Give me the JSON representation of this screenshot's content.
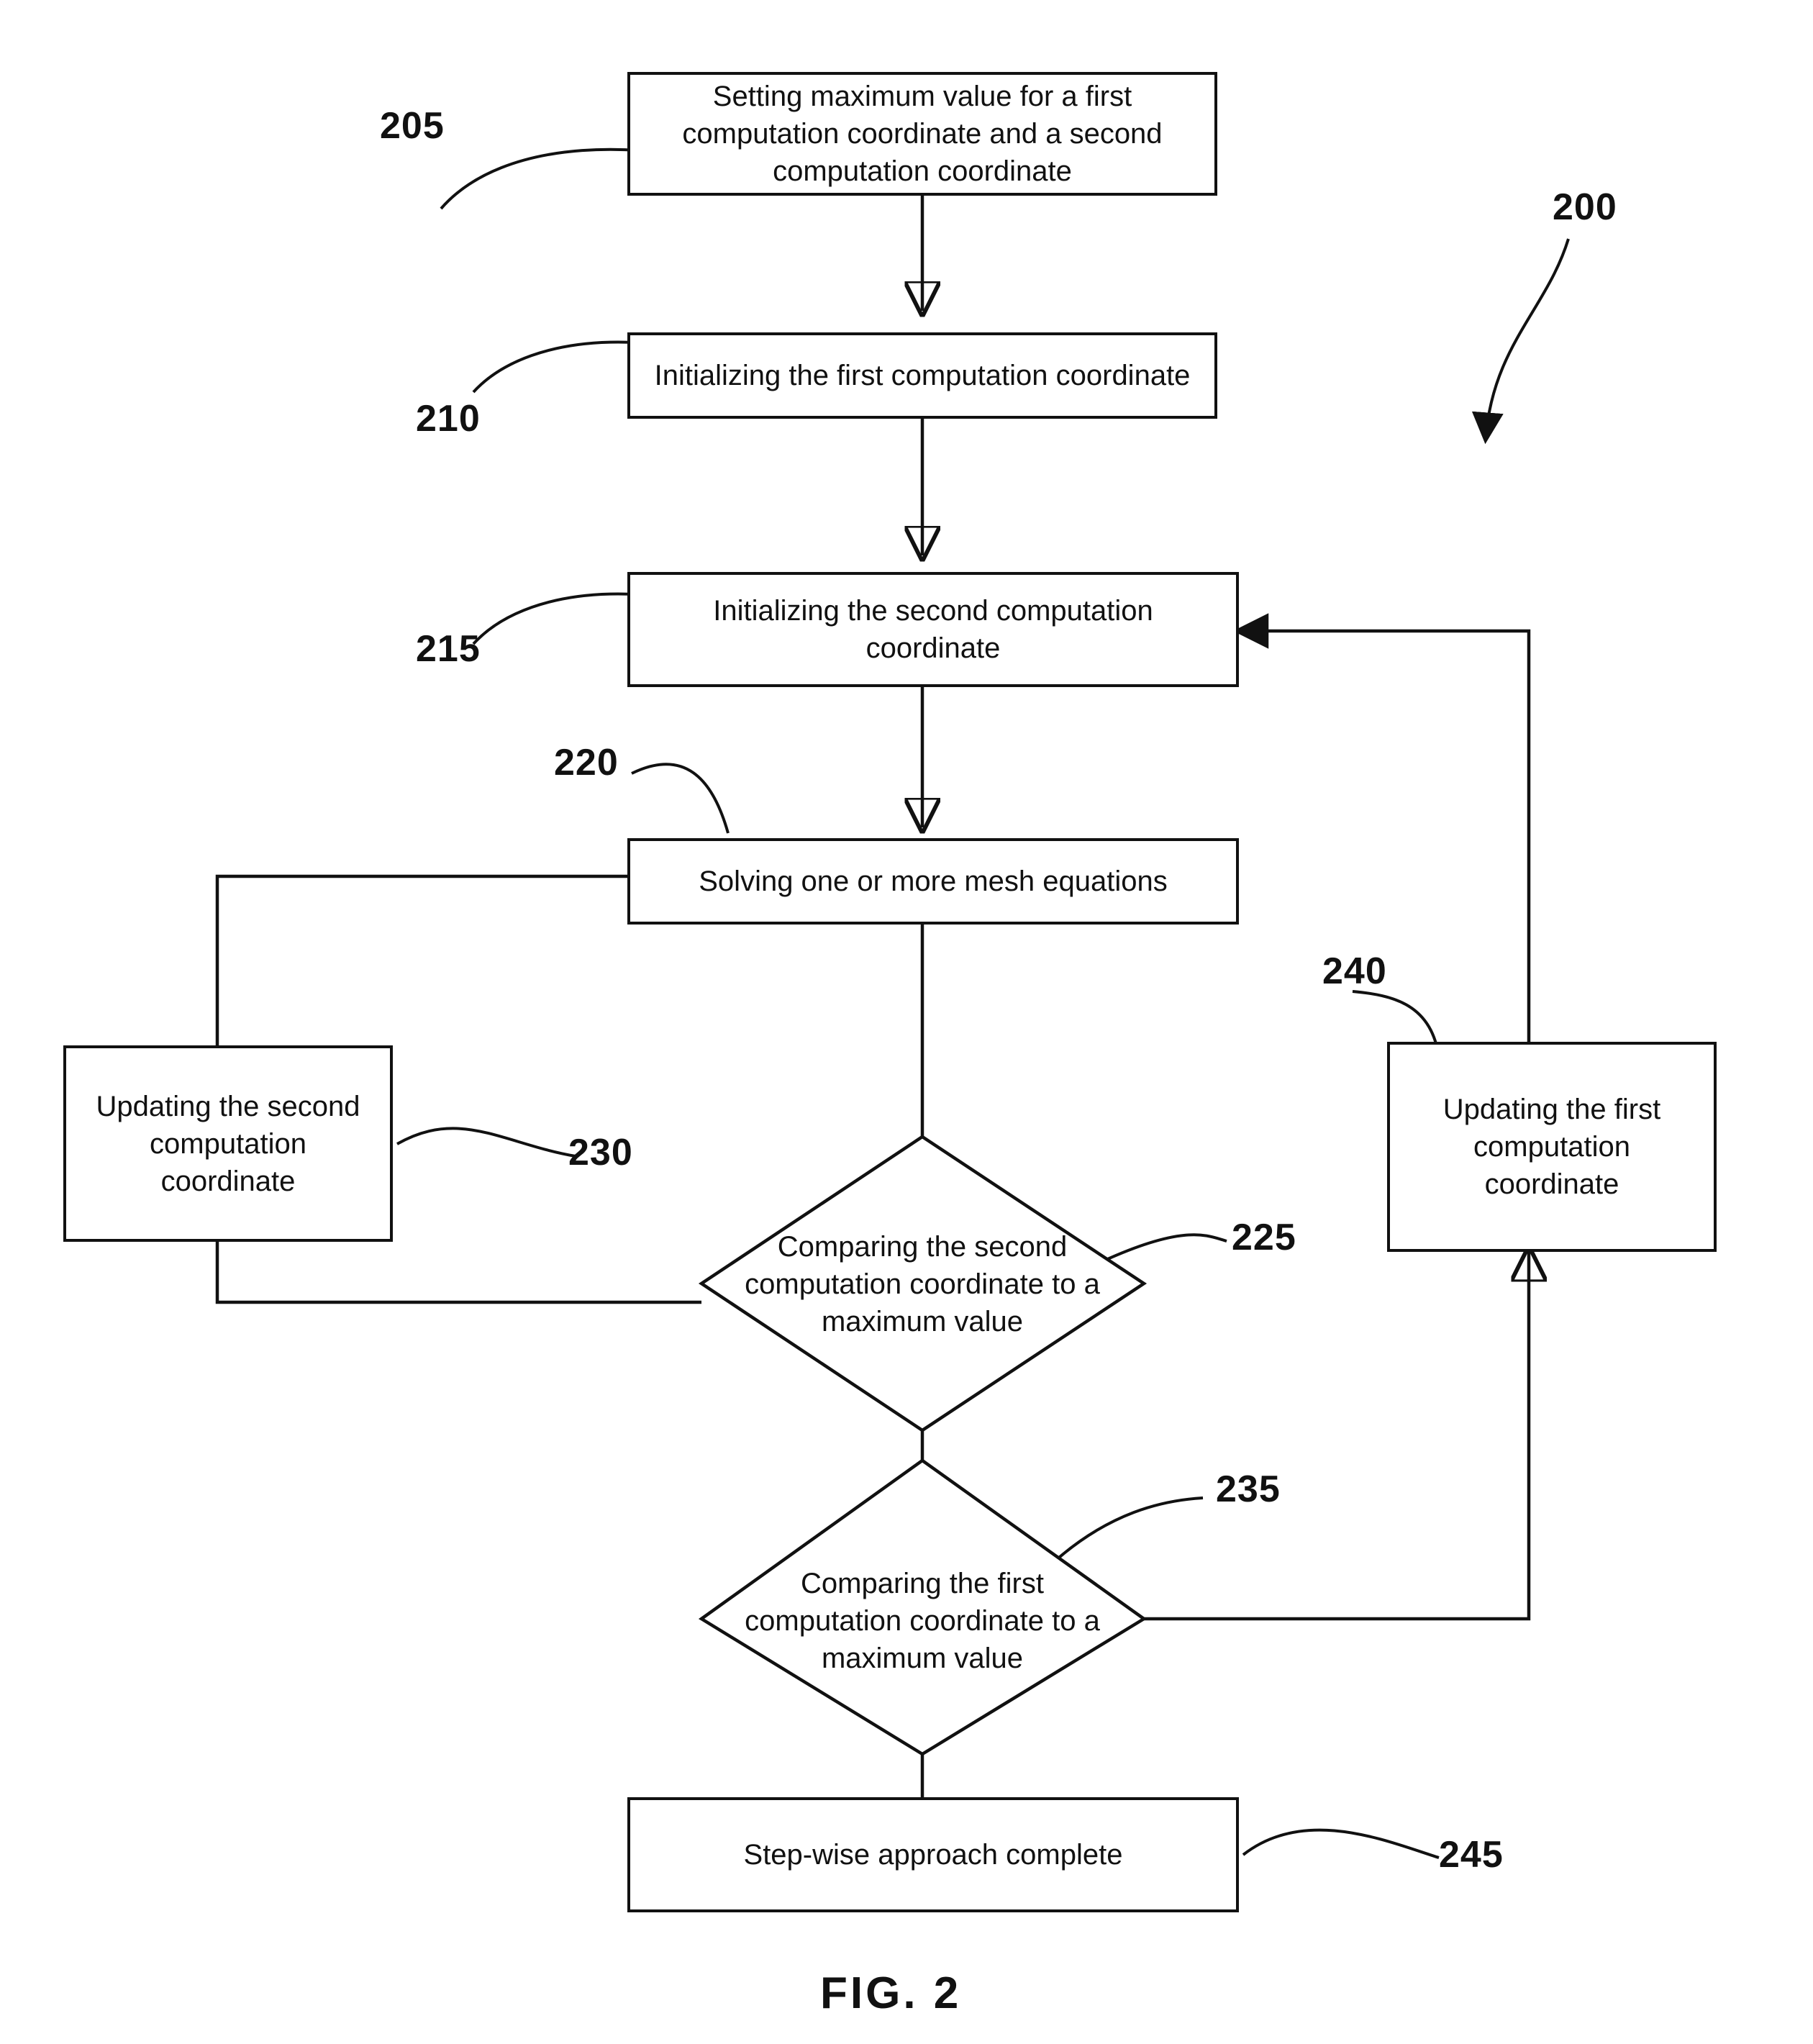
{
  "figure": {
    "caption": "FIG. 2",
    "diagram_ref": "200"
  },
  "nodes": [
    {
      "ref": "205",
      "shape": "process",
      "label": "Setting maximum value for a first computation coordinate and a second computation coordinate"
    },
    {
      "ref": "210",
      "shape": "process",
      "label": "Initializing the first computation coordinate"
    },
    {
      "ref": "215",
      "shape": "process",
      "label": "Initializing the second computation coordinate"
    },
    {
      "ref": "220",
      "shape": "process",
      "label": "Solving one or more mesh equations"
    },
    {
      "ref": "225",
      "shape": "decision",
      "label": "Comparing the second computation coordinate to a maximum value"
    },
    {
      "ref": "230",
      "shape": "process",
      "label": "Updating the second computation coordinate"
    },
    {
      "ref": "235",
      "shape": "decision",
      "label": "Comparing the first computation coordinate to a maximum value"
    },
    {
      "ref": "240",
      "shape": "process",
      "label": "Updating the first computation coordinate"
    },
    {
      "ref": "245",
      "shape": "terminal",
      "label": "Step-wise approach complete"
    }
  ],
  "edges": [
    {
      "from": "205",
      "to": "210",
      "arrow": true
    },
    {
      "from": "210",
      "to": "215",
      "arrow": true
    },
    {
      "from": "215",
      "to": "220",
      "arrow": true
    },
    {
      "from": "220",
      "to": "225",
      "arrow": false
    },
    {
      "from": "225",
      "to": "230",
      "arrow": false
    },
    {
      "from": "230",
      "to": "220",
      "arrow": false
    },
    {
      "from": "225",
      "to": "235",
      "arrow": false
    },
    {
      "from": "235",
      "to": "240",
      "arrow": true
    },
    {
      "from": "240",
      "to": "215",
      "arrow": true
    },
    {
      "from": "235",
      "to": "245",
      "arrow": false
    }
  ],
  "colors": {
    "stroke": "#111111",
    "background": "#ffffff"
  }
}
